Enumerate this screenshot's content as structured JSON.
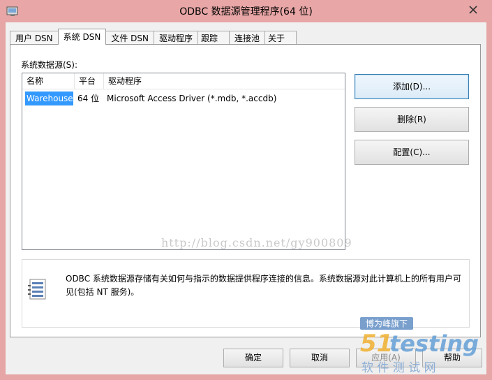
{
  "window": {
    "title": "ODBC 数据源管理程序(64 位)",
    "close_glyph": "✕"
  },
  "tabs": [
    {
      "label": "用户 DSN",
      "active": false
    },
    {
      "label": "系统 DSN",
      "active": true
    },
    {
      "label": "文件 DSN",
      "active": false
    },
    {
      "label": "驱动程序",
      "active": false
    },
    {
      "label": "跟踪",
      "active": false
    },
    {
      "label": "连接池",
      "active": false
    },
    {
      "label": "关于",
      "active": false
    }
  ],
  "panel": {
    "section_label": "系统数据源(S):",
    "columns": [
      "名称",
      "平台",
      "驱动程序"
    ],
    "rows": [
      {
        "name": "Warehouse",
        "platform": "64 位",
        "driver": "Microsoft Access Driver (*.mdb, *.accdb)"
      }
    ],
    "buttons": {
      "add": "添加(D)...",
      "remove": "删除(R)",
      "configure": "配置(C)..."
    },
    "info_text": "ODBC 系统数据源存储有关如何与指示的数据提供程序连接的信息。系统数据源对此计算机上的所有用户可见(包括 NT 服务)。",
    "watermark": "http://blog.csdn.net/gy900809"
  },
  "footer": {
    "ok": "确定",
    "cancel": "取消",
    "apply": "应用(A)",
    "help": "帮助"
  },
  "logo": {
    "line1": "博为峰旗下",
    "line2_num": "51",
    "line2_text": "testing",
    "line3": "软 件 测 试 网"
  },
  "colors": {
    "titlebar": "#e8a6a6",
    "selection": "#3399ff",
    "logo_blue": "#5b9bd5"
  }
}
